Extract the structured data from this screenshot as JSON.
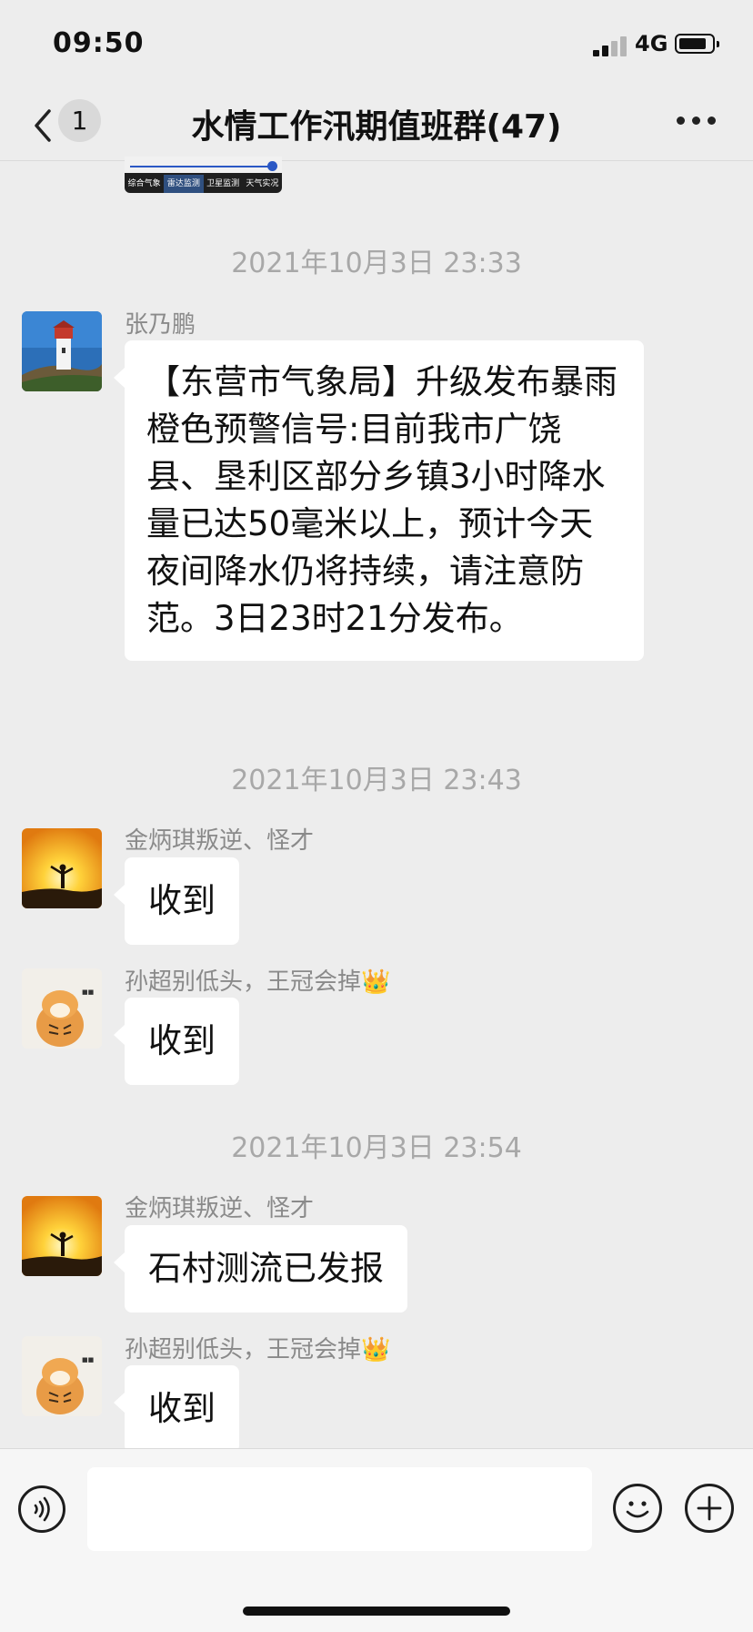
{
  "status_bar": {
    "time": "09:50",
    "network": "4G",
    "battery_level": 0.85
  },
  "nav": {
    "back_badge": "1",
    "title": "水情工作汛期值班群(47)"
  },
  "image_message": {
    "tabs": [
      "综合气象",
      "雷达监测",
      "卫星监测",
      "天气实况"
    ],
    "active_tab": "雷达监测"
  },
  "messages": [
    {
      "type": "timestamp",
      "text": "2021年10月3日 23:33"
    },
    {
      "type": "message",
      "sender": "张乃鹏",
      "avatar": "lighthouse-avatar",
      "text": "【东营市气象局】升级发布暴雨橙色预警信号:目前我市广饶县、垦利区部分乡镇3小时降水量已达50毫米以上，预计今天夜间降水仍将持续，请注意防范。3日23时21分发布。"
    },
    {
      "type": "timestamp",
      "text": "2021年10月3日 23:43"
    },
    {
      "type": "message",
      "sender": "金炳琪叛逆、怪才",
      "avatar": "sunset-avatar",
      "text": "收到"
    },
    {
      "type": "message",
      "sender": "孙超别低头，王冠会掉👑",
      "avatar": "tiger-avatar",
      "text": "收到"
    },
    {
      "type": "timestamp",
      "text": "2021年10月3日 23:54"
    },
    {
      "type": "message",
      "sender": "金炳琪叛逆、怪才",
      "avatar": "sunset-avatar",
      "text": "石村测流已发报"
    },
    {
      "type": "message",
      "sender": "孙超别低头，王冠会掉👑",
      "avatar": "tiger-avatar",
      "text": "收到"
    }
  ],
  "input": {
    "value": "",
    "placeholder": ""
  }
}
